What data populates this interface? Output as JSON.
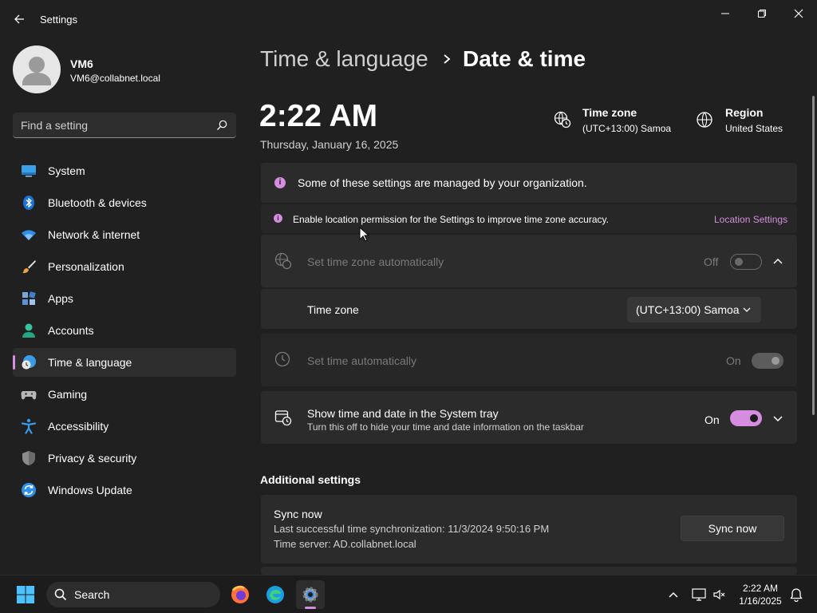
{
  "window": {
    "title": "Settings"
  },
  "profile": {
    "name": "VM6",
    "email": "VM6@collabnet.local"
  },
  "search": {
    "placeholder": "Find a setting"
  },
  "sidebar": {
    "items": [
      {
        "label": "System"
      },
      {
        "label": "Bluetooth & devices"
      },
      {
        "label": "Network & internet"
      },
      {
        "label": "Personalization"
      },
      {
        "label": "Apps"
      },
      {
        "label": "Accounts"
      },
      {
        "label": "Time & language"
      },
      {
        "label": "Gaming"
      },
      {
        "label": "Accessibility"
      },
      {
        "label": "Privacy & security"
      },
      {
        "label": "Windows Update"
      }
    ],
    "active_index": 6
  },
  "header": {
    "parent": "Time & language",
    "current": "Date & time"
  },
  "clock": {
    "time": "2:22 AM",
    "date": "Thursday, January 16, 2025"
  },
  "timezone_info": {
    "title": "Time zone",
    "value": "(UTC+13:00) Samoa"
  },
  "region_info": {
    "title": "Region",
    "value": "United States"
  },
  "notices": {
    "managed": "Some of these settings are managed by your organization.",
    "location": "Enable location permission for the Settings to improve time zone accuracy.",
    "location_link": "Location Settings"
  },
  "settings": {
    "tz_auto": {
      "label": "Set time zone automatically",
      "state": "Off"
    },
    "time_zone": {
      "label": "Time zone",
      "value": "(UTC+13:00) Samoa"
    },
    "time_auto": {
      "label": "Set time automatically",
      "state": "On"
    },
    "tray": {
      "label": "Show time and date in the System tray",
      "desc": "Turn this off to hide your time and date information on the taskbar",
      "state": "On"
    }
  },
  "additional": {
    "title": "Additional settings",
    "sync": {
      "title": "Sync now",
      "last": "Last successful time synchronization: 11/3/2024 9:50:16 PM",
      "server": "Time server: AD.collabnet.local",
      "button": "Sync now"
    }
  },
  "taskbar": {
    "search_label": "Search",
    "time": "2:22 AM",
    "date": "1/16/2025"
  },
  "colors": {
    "accent": "#d58de0",
    "background": "#202020",
    "card": "#2b2b2b"
  }
}
